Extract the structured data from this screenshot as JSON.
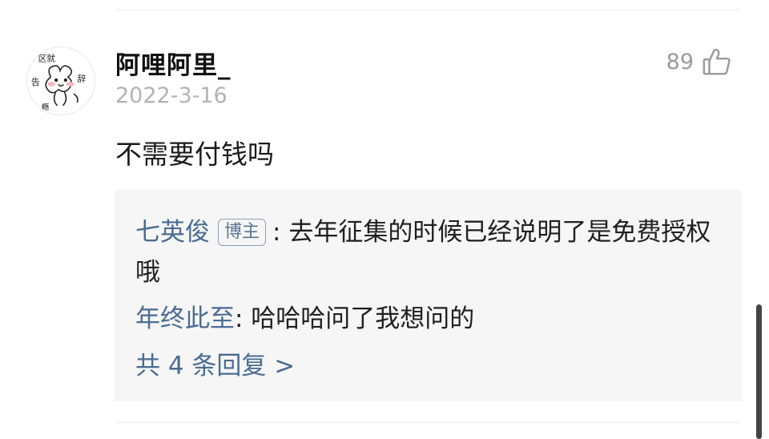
{
  "comment": {
    "username": "阿哩阿里_",
    "date": "2022-3-16",
    "likes": "89",
    "text": "不需要付钱吗",
    "avatar_icon": "doodle-avatar-icon",
    "avatar_text": "区就 告 辞 瘾"
  },
  "replies": [
    {
      "name": "七英俊",
      "badge": "博主",
      "separator": ":",
      "text": " 去年征集的时候已经说明了是免费授权哦"
    },
    {
      "name": "年终此至",
      "badge": "",
      "separator": ":",
      "text": " 哈哈哈问了我想问的"
    }
  ],
  "more_replies": "共 4 条回复 >",
  "icons": {
    "like": "thumbs-up-icon"
  },
  "colors": {
    "link": "#4a6c93",
    "muted": "#b3b3b3",
    "panel": "#f6f6f6"
  }
}
